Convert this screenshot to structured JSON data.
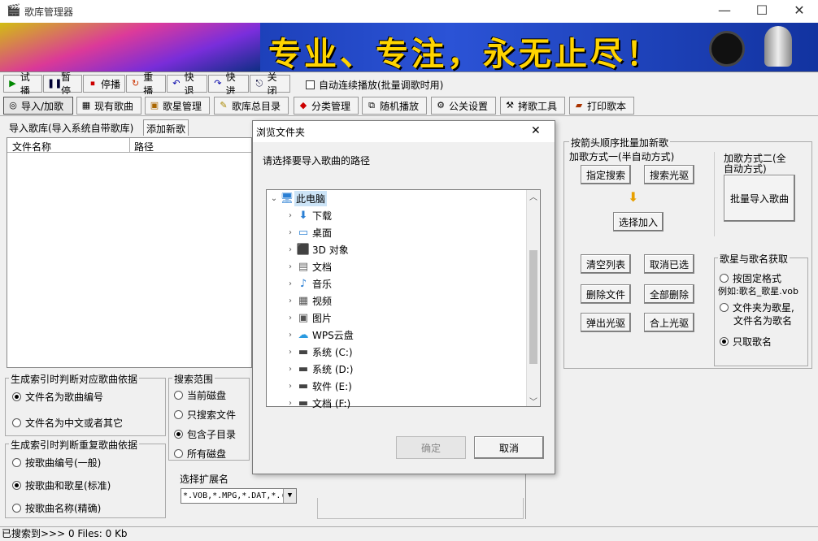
{
  "window": {
    "title": "歌库管理器",
    "minimize": "—",
    "maximize": "☐",
    "close": "✕",
    "banner_text": "专业、专注，永无止尽！"
  },
  "toolbar1": {
    "items": [
      "试播",
      "暂停",
      "停播",
      "重播",
      "快退",
      "快进",
      "关闭"
    ],
    "auto_play_label": "自动连续播放(批量调歌时用)"
  },
  "toolbar2": {
    "items": [
      "导入/加歌",
      "现有歌曲",
      "歌星管理",
      "歌库总目录",
      "分类管理",
      "随机播放",
      "公关设置",
      "拷歌工具",
      "打印歌本"
    ]
  },
  "subtabs": [
    "导入歌库(导入系统自带歌库)",
    "添加新歌"
  ],
  "file_list": {
    "col_name": "文件名称",
    "col_path": "路径"
  },
  "index_basis": {
    "title": "生成索引时判断对应歌曲依据",
    "options": [
      "文件名为歌曲编号",
      "文件名为中文或者其它"
    ],
    "selected": 0
  },
  "dup_basis": {
    "title": "生成索引时判断重复歌曲依据",
    "options": [
      "按歌曲编号(一般)",
      "按歌曲和歌星(标准)",
      "按歌曲名称(精确)"
    ],
    "selected": 1
  },
  "search_scope": {
    "title": "搜索范围",
    "options": [
      "当前磁盘",
      "只搜索文件",
      "包含子目录",
      "所有磁盘"
    ],
    "selected": 2
  },
  "ext": {
    "label": "选择扩展名",
    "value": "*.VOB,*.MPG,*.DAT,*.("
  },
  "right_panel": {
    "title": "按箭头顺序批量加新歌",
    "mode1": "加歌方式一(半自动方式)",
    "mode2": "加歌方式二(全自动方式)",
    "btn_specify": "指定搜索",
    "btn_cdrom": "搜索光驱",
    "btn_select_add": "选择加入",
    "btn_batch": "批量导入歌曲",
    "btn_clear": "清空列表",
    "btn_cancel_sel": "取消已选",
    "btn_delete_file": "删除文件",
    "btn_delete_all": "全部删除",
    "btn_eject": "弹出光驱",
    "btn_close_cd": "合上光驱",
    "star_group_title": "歌星与歌名获取",
    "star_opts": [
      "按固定格式",
      "例如:歌名_歌星.vob",
      "文件夹为歌星,",
      "文件名为歌名",
      "只取歌名"
    ],
    "star_selected": 2
  },
  "dialog": {
    "title": "浏览文件夹",
    "close": "✕",
    "prompt": "请选择要导入歌曲的路径",
    "root": "此电脑",
    "items": [
      "下载",
      "桌面",
      "3D 对象",
      "文档",
      "音乐",
      "视频",
      "图片",
      "WPS云盘",
      "系统 (C:)",
      "系统 (D:)",
      "软件 (E:)",
      "文档 (F:)"
    ],
    "icons": [
      "download-icon",
      "desktop-icon",
      "3d-objects-icon",
      "documents-icon",
      "music-icon",
      "videos-icon",
      "pictures-icon",
      "cloud-icon",
      "drive-icon",
      "drive-icon",
      "drive-icon",
      "drive-icon"
    ],
    "ok": "确定",
    "cancel": "取消"
  },
  "status": "已搜索到>>> 0 Files: 0 Kb"
}
